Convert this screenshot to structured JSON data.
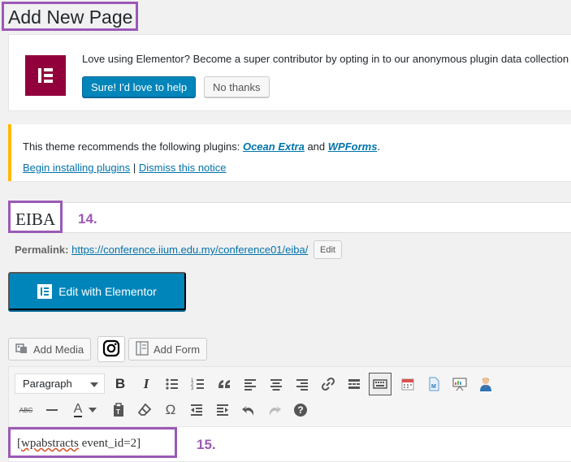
{
  "page": {
    "title": "Add New Page"
  },
  "elementor_notice": {
    "message": "Love using Elementor? Become a super contributor by opting in to our anonymous plugin data collection",
    "accept_label": "Sure! I'd love to help",
    "decline_label": "No thanks"
  },
  "theme_notice": {
    "prefix": "This theme recommends the following plugins: ",
    "plugin1": "Ocean Extra",
    "and": " and ",
    "plugin2": "WPForms",
    "suffix": ".",
    "begin_link": "Begin installing plugins",
    "separator": " | ",
    "dismiss_link": "Dismiss this notice"
  },
  "post": {
    "title_value": "EIBA",
    "annotation_title": "14.",
    "permalink_label": "Permalink:",
    "permalink_base": "https://conference.iium.edu.my/conference01/",
    "permalink_slug": "eiba",
    "permalink_end": "/",
    "edit_label": "Edit"
  },
  "elementor_button": {
    "label": "Edit with Elementor"
  },
  "media_buttons": {
    "add_media": "Add Media",
    "add_form": "Add Form"
  },
  "toolbar": {
    "format_value": "Paragraph",
    "row1_icons": [
      "bold-icon",
      "italic-icon",
      "bullet-list-icon",
      "numbered-list-icon",
      "blockquote-icon",
      "align-left-icon",
      "align-center-icon",
      "align-right-icon",
      "link-icon",
      "read-more-icon",
      "toolbar-toggle-icon",
      "calendar-icon",
      "document-icon",
      "presentation-icon",
      "user-icon"
    ],
    "row2_icons": [
      "strikethrough-icon",
      "horizontal-line-icon",
      "text-color-icon",
      "paste-text-icon",
      "clear-formatting-icon",
      "special-character-icon",
      "outdent-icon",
      "indent-icon",
      "undo-icon",
      "redo-icon",
      "help-icon"
    ],
    "bold": "B",
    "italic": "I",
    "abc": "ABC",
    "text_color": "A",
    "omega": "Ω",
    "help": "?"
  },
  "editor": {
    "shortcode_open": "[",
    "shortcode_word": "wpabstracts",
    "shortcode_rest": " event_id=2]",
    "annotation": "15."
  },
  "colors": {
    "accent": "#0085ba",
    "annotation": "#9b59b6",
    "elementor": "#92003b",
    "warning": "#ffb900"
  }
}
